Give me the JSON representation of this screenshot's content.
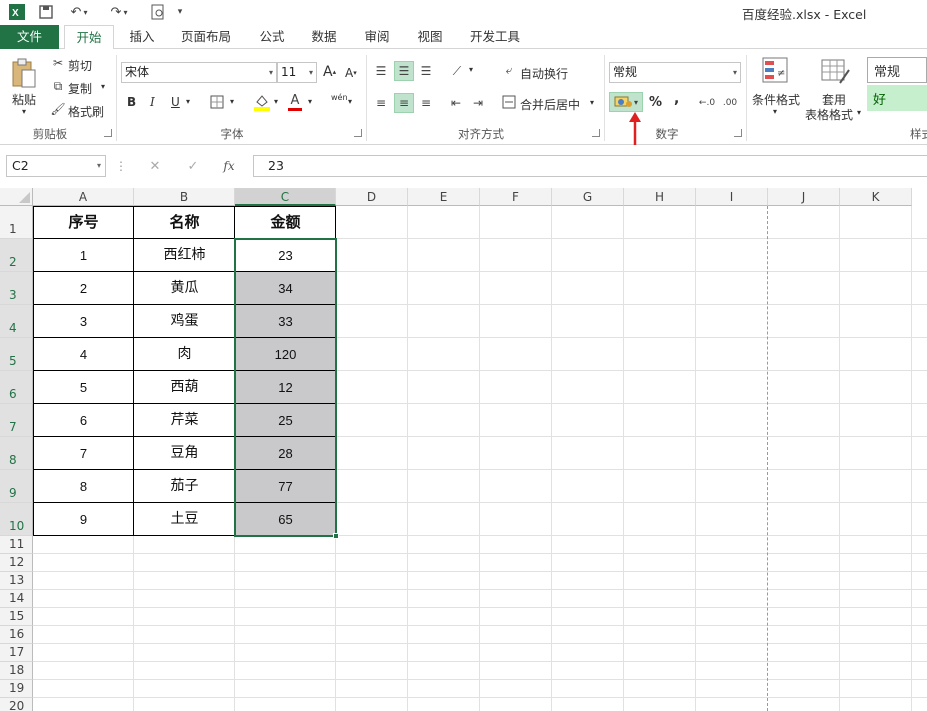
{
  "window": {
    "title": "百度经验.xlsx - Excel",
    "quick_access": [
      "excel-logo-icon",
      "save-icon",
      "undo-icon",
      "redo-icon",
      "print-preview-icon",
      "customize-icon"
    ]
  },
  "tabs": [
    "文件",
    "开始",
    "插入",
    "页面布局",
    "公式",
    "数据",
    "审阅",
    "视图",
    "开发工具"
  ],
  "active_tab": "开始",
  "ribbon": {
    "clipboard": {
      "label": "剪贴板",
      "paste": "粘贴",
      "cut": "剪切",
      "copy": "复制",
      "format_painter": "格式刷"
    },
    "font": {
      "label": "字体",
      "font_name": "宋体",
      "font_size": "11",
      "grow": "A",
      "shrink": "A",
      "bold": "B",
      "italic": "I",
      "underline": "U",
      "font_color_letter": "A",
      "phonetic": "wén"
    },
    "alignment": {
      "label": "对齐方式",
      "wrap_text": "自动换行",
      "merge_center": "合并后居中"
    },
    "number": {
      "label": "数字",
      "format": "常规",
      "percent": "%",
      "comma": ","
    },
    "styles": {
      "conditional_format": "条件格式",
      "format_as_table_1": "套用",
      "format_as_table_2": "表格格式",
      "normal": "常规",
      "good": "好",
      "label_partial": "样式"
    }
  },
  "formula_bar": {
    "name_box": "C2",
    "fx": "fx",
    "value": "23"
  },
  "columns": [
    "A",
    "B",
    "C",
    "D",
    "E",
    "F",
    "G",
    "H",
    "I",
    "J",
    "K"
  ],
  "selected_column": "C",
  "rows": [
    "1",
    "2",
    "3",
    "4",
    "5",
    "6",
    "7",
    "8",
    "9",
    "10",
    "11",
    "12",
    "13",
    "14",
    "15",
    "16",
    "17",
    "18",
    "19",
    "20"
  ],
  "table": {
    "headers": [
      "序号",
      "名称",
      "金额"
    ],
    "rows": [
      [
        "1",
        "西红柿",
        "23"
      ],
      [
        "2",
        "黄瓜",
        "34"
      ],
      [
        "3",
        "鸡蛋",
        "33"
      ],
      [
        "4",
        "肉",
        "120"
      ],
      [
        "5",
        "西葫",
        "12"
      ],
      [
        "6",
        "芹菜",
        "25"
      ],
      [
        "7",
        "豆角",
        "28"
      ],
      [
        "8",
        "茄子",
        "77"
      ],
      [
        "9",
        "土豆",
        "65"
      ]
    ]
  },
  "colors": {
    "excel_green": "#217346",
    "selection_fill": "#c9c8ca",
    "annotation_arrow": "#e02020"
  }
}
